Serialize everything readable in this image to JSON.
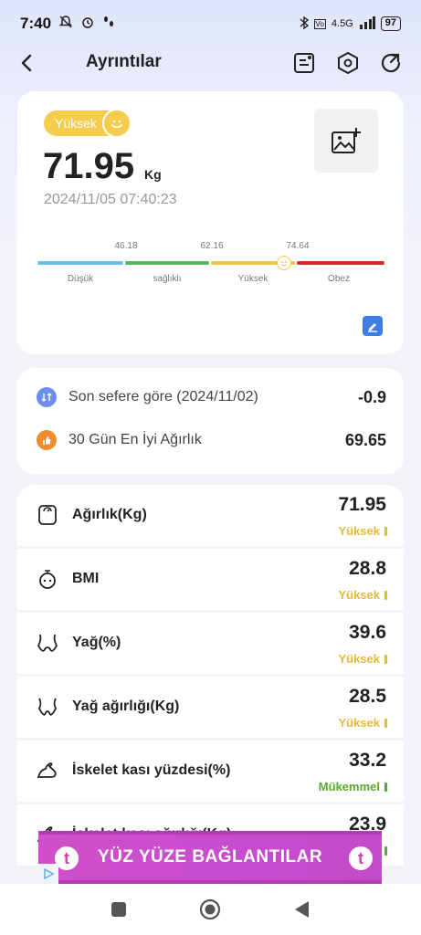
{
  "status_bar": {
    "time": "7:40",
    "network": "4.5G",
    "battery": "97"
  },
  "header": {
    "title": "Ayrıntılar"
  },
  "summary": {
    "badge": "Yüksek",
    "weight": "71.95",
    "unit": "Kg",
    "datetime": "2024/11/05 07:40:23",
    "scale": {
      "ticks": [
        "46.18",
        "62.16",
        "74.64"
      ],
      "segments": [
        "Düşük",
        "sağlıklı",
        "Yüksek",
        "Obez"
      ],
      "segment_colors": [
        "#5fc3e8",
        "#58b85c",
        "#f2c744",
        "#d8262c"
      ],
      "marker_value": 71.95
    }
  },
  "comparison": {
    "rows": [
      {
        "label": "Son sefere göre (2024/11/02)",
        "value": "-0.9",
        "icon": "compare-icon",
        "color": "#6b8ef0"
      },
      {
        "label": "30 Gün En İyi Ağırlık",
        "value": "69.65",
        "icon": "thumbs-up-icon",
        "color": "#f28a2e"
      }
    ]
  },
  "metrics": [
    {
      "label": "Ağırlık(Kg)",
      "value": "71.95",
      "status": "Yüksek",
      "status_color": "#e9b936",
      "icon": "scale-icon"
    },
    {
      "label": "BMI",
      "value": "28.8",
      "status": "Yüksek",
      "status_color": "#e9b936",
      "icon": "bmi-icon"
    },
    {
      "label": "Yağ(%)",
      "value": "39.6",
      "status": "Yüksek",
      "status_color": "#e9b936",
      "icon": "body-fat-icon"
    },
    {
      "label": "Yağ ağırlığı(Kg)",
      "value": "28.5",
      "status": "Yüksek",
      "status_color": "#e9b936",
      "icon": "fat-weight-icon"
    },
    {
      "label": "İskelet kası yüzdesi(%)",
      "value": "33.2",
      "status": "Mükemmel",
      "status_color": "#5ba82e",
      "icon": "muscle-icon"
    },
    {
      "label": "İskelet kası ağırlığı(Kg)",
      "value": "23.9",
      "status": "",
      "status_color": "#5ba82e",
      "icon": "muscle-weight-icon"
    }
  ],
  "ad": {
    "text": "YÜZ YÜZE BAĞLANTILAR"
  }
}
